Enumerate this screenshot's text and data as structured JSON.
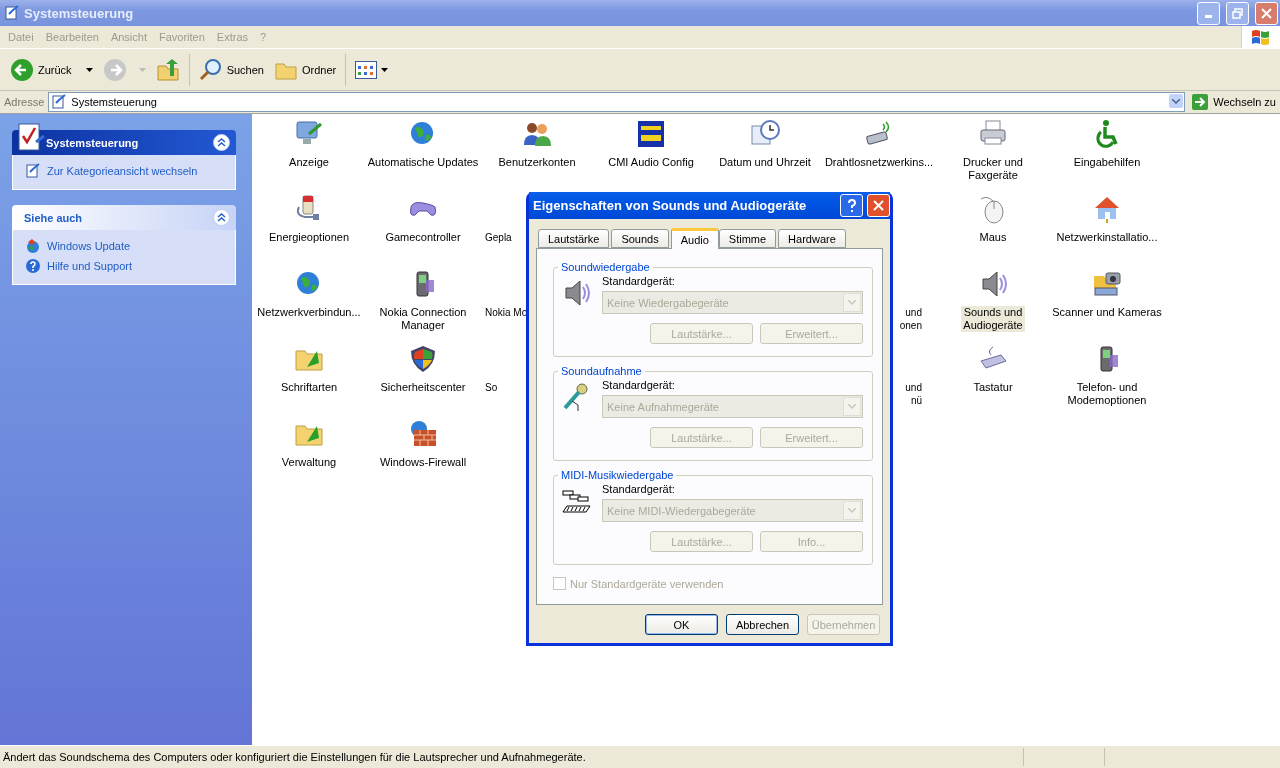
{
  "window": {
    "title": "Systemsteuerung"
  },
  "menu": [
    "Datei",
    "Bearbeiten",
    "Ansicht",
    "Favoriten",
    "Extras",
    "?"
  ],
  "toolbar": [
    {
      "kind": "back",
      "label": "Zurück",
      "disabled": false
    },
    {
      "kind": "forward",
      "disabled": true
    },
    {
      "kind": "up"
    },
    {
      "kind": "search",
      "label": "Suchen"
    },
    {
      "kind": "folders",
      "label": "Ordner"
    },
    {
      "kind": "views"
    }
  ],
  "address": {
    "label": "Adresse",
    "value": "Systemsteuerung",
    "go": "Wechseln zu"
  },
  "sidebar": [
    {
      "kind": "main",
      "title": "Systemsteuerung",
      "expanded": true,
      "links": [
        {
          "label": "Zur Kategorieansicht wechseln"
        }
      ]
    },
    {
      "kind": "plain",
      "title": "Siehe auch",
      "expanded": true,
      "links": [
        {
          "label": "Windows Update"
        },
        {
          "label": "Hilfe und Support"
        }
      ]
    }
  ],
  "icon_rows": [
    [
      {
        "lines": [
          "Anzeige"
        ],
        "selected": false
      },
      {
        "lines": [
          "Automatische Updates"
        ],
        "selected": false
      },
      {
        "lines": [
          "Benutzerkonten"
        ],
        "selected": false
      },
      {
        "lines": [
          "CMI Audio Config"
        ],
        "selected": false
      },
      {
        "lines": [
          "Datum und Uhrzeit"
        ],
        "selected": false
      },
      {
        "lines": [
          "Drahtlosnetzwerkins..."
        ],
        "selected": false
      },
      {
        "lines": [
          "Drucker und",
          "Faxgeräte"
        ],
        "selected": false
      },
      {
        "lines": [
          "Eingabehilfen"
        ],
        "selected": false
      }
    ],
    [
      {
        "lines": [
          "Energieoptionen"
        ],
        "selected": false
      },
      {
        "lines": [
          "Gamecontroller"
        ],
        "selected": false
      },
      {
        "lines": [
          "Gepla"
        ],
        "selected": false,
        "kind": "cut_right"
      },
      {
        "lines": [
          "Maus"
        ],
        "selected": false
      },
      {
        "lines": [
          "Netzwerkinstallatio..."
        ],
        "selected": false
      }
    ],
    [
      {
        "lines": [
          "Netzwerkverbindun..."
        ],
        "selected": false
      },
      {
        "lines": [
          "Nokia Connection",
          "Manager"
        ],
        "selected": false
      },
      {
        "lines": [
          "Nokia Mo"
        ],
        "selected": false,
        "kind": "cut_right"
      },
      {
        "lines": [
          "und",
          "onen"
        ],
        "selected": false,
        "kind": "cut_left"
      },
      {
        "lines": [
          "Sounds und",
          "Audiogeräte"
        ],
        "selected": true
      },
      {
        "lines": [
          "Scanner und Kameras"
        ],
        "selected": false
      }
    ],
    [
      {
        "lines": [
          "Schriftarten"
        ],
        "selected": false
      },
      {
        "lines": [
          "Sicherheitscenter"
        ],
        "selected": false
      },
      {
        "lines": [
          "So"
        ],
        "selected": false,
        "kind": "cut_right"
      },
      {
        "lines": [
          "und",
          "nü"
        ],
        "selected": false,
        "kind": "cut_left"
      },
      {
        "lines": [
          "Tastatur"
        ],
        "selected": false
      },
      {
        "lines": [
          "Telefon- und",
          "Modemoptionen"
        ],
        "selected": false
      }
    ],
    [
      {
        "lines": [
          "Verwaltung"
        ],
        "selected": false
      },
      {
        "lines": [
          "Windows-Firewall"
        ],
        "selected": false
      }
    ]
  ],
  "dialog": {
    "title": "Eigenschaften von Sounds und Audiogeräte",
    "tabs": [
      {
        "label": "Lautstärke",
        "selected": false
      },
      {
        "label": "Sounds",
        "selected": false
      },
      {
        "label": "Audio",
        "selected": true
      },
      {
        "label": "Stimme",
        "selected": false
      },
      {
        "label": "Hardware",
        "selected": false
      }
    ],
    "groups": [
      {
        "title": "Soundwiedergabe",
        "label": "Standardgerät:",
        "device": "Keine Wiedergabegeräte",
        "disabled": true,
        "buttons": [
          "Lautstärke...",
          "Erweitert..."
        ]
      },
      {
        "title": "Soundaufnahme",
        "label": "Standardgerät:",
        "device": "Keine Aufnahmegeräte",
        "disabled": true,
        "buttons": [
          "Lautstärke...",
          "Erweitert..."
        ]
      },
      {
        "title": "MIDI-Musikwiedergabe",
        "label": "Standardgerät:",
        "device": "Keine MIDI-Wiedergabegeräte",
        "disabled": true,
        "buttons": [
          "Lautstärke...",
          "Info..."
        ]
      }
    ],
    "checkbox": {
      "label": "Nur Standardgeräte verwenden",
      "checked": false,
      "disabled": true
    },
    "buttons": [
      {
        "label": "OK",
        "default": true,
        "disabled": false
      },
      {
        "label": "Abbrechen",
        "default": false,
        "disabled": false
      },
      {
        "label": "Übernehmen",
        "default": false,
        "disabled": true
      }
    ]
  },
  "status_bar": {
    "text": "Ändert das Soundschema des Computers oder konfiguriert die Einstellungen für die Lautsprecher und Aufnahmegeräte."
  }
}
